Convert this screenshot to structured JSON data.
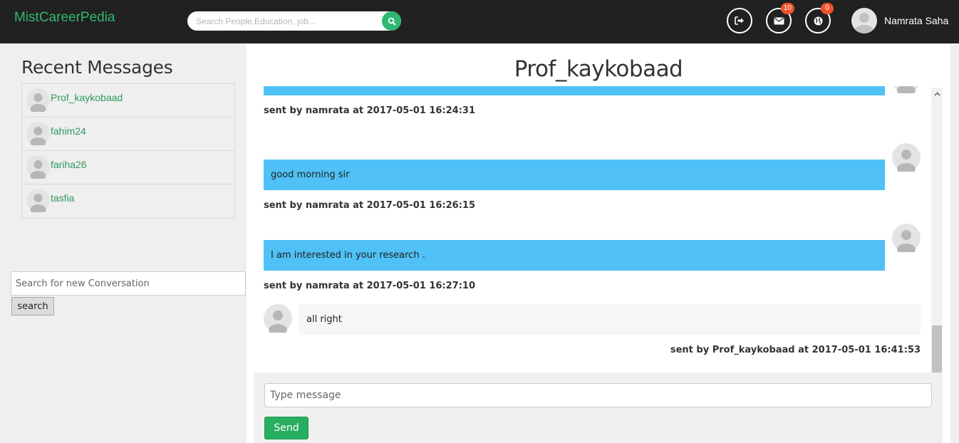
{
  "navbar": {
    "brand": "MistCareerPedia",
    "search_placeholder": "Search People,Education, job...",
    "messages_badge": "10",
    "notifications_badge": "0",
    "user_name": "Namrata Saha"
  },
  "sidebar": {
    "title": "Recent Messages",
    "contacts": [
      {
        "name": "Prof_kaykobaad"
      },
      {
        "name": "fahim24"
      },
      {
        "name": "fariha26"
      },
      {
        "name": "tasfia"
      }
    ],
    "new_conversation_placeholder": "Search for new Conversation",
    "search_button": "search"
  },
  "chat": {
    "title": "Prof_kaykobaad",
    "messages": [
      {
        "direction": "sent",
        "text": "",
        "meta": "sent by namrata at 2017-05-01 16:24:31"
      },
      {
        "direction": "sent",
        "text": "good morning sir",
        "meta": "sent by namrata at 2017-05-01 16:26:15"
      },
      {
        "direction": "sent",
        "text": "I am interested in your research .",
        "meta": "sent by namrata at 2017-05-01 16:27:10"
      },
      {
        "direction": "received",
        "text": "all right",
        "meta": "sent by Prof_kaykobaad at 2017-05-01 16:41:53"
      }
    ],
    "input_placeholder": "Type message",
    "send_label": "Send"
  },
  "colors": {
    "brand_green": "#2eb872",
    "sent_bubble": "#4fc1f6",
    "navbar_bg": "#212121",
    "badge": "#f0522b",
    "send_button": "#27ae60"
  },
  "icons": [
    "search-icon",
    "logout-icon",
    "envelope-icon",
    "globe-icon",
    "user-avatar-icon",
    "chevron-up-icon",
    "chevron-down-icon"
  ]
}
